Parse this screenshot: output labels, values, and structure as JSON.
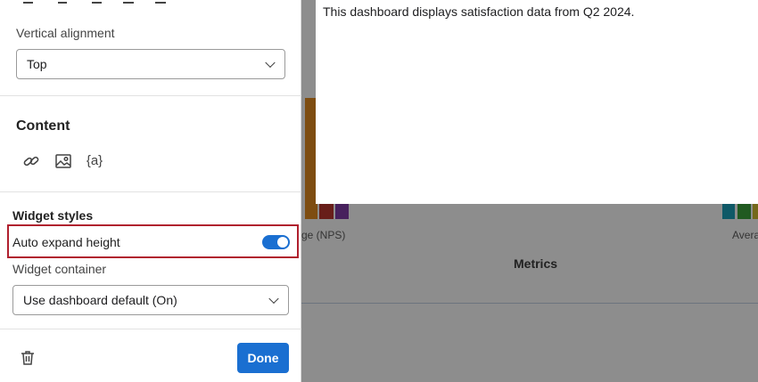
{
  "panel": {
    "vertical_alignment_label": "Vertical alignment",
    "vertical_alignment_value": "Top",
    "content_title": "Content",
    "content_icons": [
      "link-icon",
      "image-icon",
      "piped-text-icon"
    ],
    "piped_text_glyph": "{a}",
    "widget_styles_title": "Widget styles",
    "auto_expand_label": "Auto expand height",
    "auto_expand_on": true,
    "widget_container_label": "Widget container",
    "widget_container_value": "Use dashboard default (On)",
    "done_label": "Done"
  },
  "preview": {
    "text": "This dashboard displays satisfaction data from Q2 2024."
  },
  "background": {
    "nps_label_fragment": "ge (NPS)",
    "avg_label_fragment": "Avera",
    "metrics_label": "Metrics"
  },
  "colors": {
    "primary": "#1a6fd1",
    "highlight": "#b0202e",
    "bar_orange": "#d9861e",
    "bar_red": "#b3342c",
    "bar_purple": "#7b3aa0",
    "bar_teal": "#1a9ab1",
    "bar_green": "#3a9b3a"
  }
}
